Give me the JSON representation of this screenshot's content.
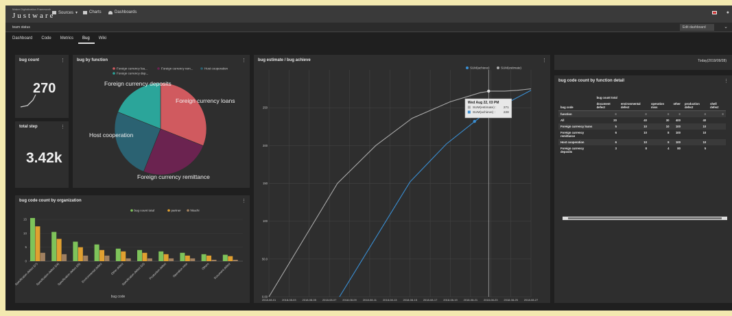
{
  "app": {
    "logo_small": "Maker Digitalization Framework",
    "logo": "Justware",
    "nav": [
      {
        "label": "Sources",
        "icon": "list-icon"
      },
      {
        "label": "Charts",
        "icon": "bar-chart-icon"
      },
      {
        "label": "Dashboards",
        "icon": "dashboard-icon"
      }
    ],
    "subtitle": "team status",
    "edit_button": "Edit dashboard"
  },
  "tabs": [
    "Dashboard",
    "Code",
    "Metrics",
    "Bug",
    "Wiki"
  ],
  "active_tab": "Bug",
  "bug_count": {
    "title": "bug count",
    "value": "270"
  },
  "total_step": {
    "title": "total step",
    "value": "3.42k"
  },
  "date_panel": {
    "text": "Today(2019/09/28)"
  },
  "pie": {
    "title": "bug by function",
    "legend": [
      "Foreign currency loa...",
      "Foreign currency rem...",
      "Host cooperation",
      "Foreign currency dep..."
    ],
    "labels": [
      "Foreign currency loans",
      "Foreign currency remittance",
      "Host cooperation",
      "Foreign currency deposits"
    ]
  },
  "bars": {
    "title": "bug code count by organization",
    "legend": [
      "bug count total",
      "partner",
      "hitachi"
    ],
    "xlabel": "bug code",
    "categories": [
      "Specification defect (07)",
      "Specification defect (04)",
      "Specification defect (05)",
      "Environmental defect",
      "Other defect",
      "Specification defect (02)",
      "Production defect",
      "Operation miss",
      "Others",
      "Document defect"
    ]
  },
  "line": {
    "title": "bug estimate / bug achieve",
    "legend": [
      "SUM(achieve)",
      "SUM(estimate)"
    ],
    "tooltip_title": "Wed Aug 22, 03 PM",
    "tooltip_rows": [
      {
        "label": "SUM(estimate)",
        "value": "271"
      },
      {
        "label": "SUM(achieve)",
        "value": "228"
      }
    ]
  },
  "table": {
    "title": "bug code count by function detail",
    "group_header": "bug count total",
    "row_header": "bug code",
    "subheader": "function",
    "columns": [
      "document defect",
      "environmental defect",
      "operation miss",
      "other",
      "production defect",
      "shell defect"
    ],
    "rows": [
      {
        "label": "All",
        "values": [
          "20",
          "40",
          "30",
          "400",
          "40"
        ]
      },
      {
        "label": "Foreign currency loans",
        "values": [
          "5",
          "10",
          "10",
          "100",
          "10"
        ]
      },
      {
        "label": "Foreign currency remittance",
        "values": [
          "6",
          "10",
          "8",
          "100",
          "10"
        ]
      },
      {
        "label": "Host cooperation",
        "values": [
          "6",
          "10",
          "9",
          "100",
          "10"
        ]
      },
      {
        "label": "Foreign currency deposits",
        "values": [
          "3",
          "8",
          "4",
          "80",
          "5"
        ]
      }
    ]
  },
  "chart_data": [
    {
      "type": "pie",
      "title": "bug by function",
      "categories": [
        "Foreign currency loans",
        "Foreign currency remittance",
        "Host cooperation",
        "Foreign currency deposits"
      ],
      "values": [
        31,
        25,
        25,
        19
      ],
      "colors": [
        "#d05a5f",
        "#6b2350",
        "#2b6272",
        "#2ba59a"
      ]
    },
    {
      "type": "bar",
      "title": "bug code count by organization",
      "xlabel": "bug code",
      "ylabel": "",
      "ylim": [
        0,
        16
      ],
      "yticks": [
        0,
        5,
        10,
        15
      ],
      "categories": [
        "Specification defect (07)",
        "Specification defect (04)",
        "Specification defect (05)",
        "Environmental defect",
        "Other defect",
        "Specification defect (02)",
        "Production defect",
        "Operation miss",
        "Others",
        "Document defect"
      ],
      "series": [
        {
          "name": "bug count total",
          "color": "#7ec35a",
          "values": [
            15.5,
            10.5,
            7,
            6,
            4.5,
            4,
            3.5,
            3,
            2.5,
            2.3
          ]
        },
        {
          "name": "partner",
          "color": "#e0a030",
          "values": [
            12.5,
            8,
            5,
            4,
            3.5,
            3,
            2.5,
            2,
            2,
            1.8
          ]
        },
        {
          "name": "hitachi",
          "color": "#a08060",
          "values": [
            3,
            2.5,
            2,
            2,
            1,
            1,
            1,
            1,
            0.5,
            0.5
          ]
        }
      ]
    },
    {
      "type": "line",
      "title": "bug estimate / bug achieve",
      "x": [
        "2018-08-01",
        "2018-08-03",
        "2018-08-05",
        "2018-08-07",
        "2018-08-09",
        "2018-08-11",
        "2018-08-13",
        "2018-08-15",
        "2018-08-17",
        "2018-08-19",
        "2018-08-21",
        "2018-08-23",
        "2018-08-25",
        "2018-08-27"
      ],
      "ylim": [
        0,
        300
      ],
      "yticks": [
        0,
        50,
        100,
        150,
        200,
        250
      ],
      "yticklabels": [
        "0.00",
        "50.0",
        "100",
        "150",
        "200",
        "250"
      ],
      "series": [
        {
          "name": "SUM(estimate)",
          "color": "#aaaaaa",
          "x_index": [
            0,
            1.7,
            3.4,
            5.3,
            7.1,
            9,
            10.5,
            11,
            11.7,
            12.3,
            13
          ],
          "values": [
            0,
            75,
            150,
            200,
            236,
            258,
            270,
            272,
            272,
            273,
            275
          ]
        },
        {
          "name": "SUM(achieve)",
          "color": "#3a8fd4",
          "x_index": [
            3.5,
            7,
            8.8,
            10.5,
            11,
            11.8,
            12.5,
            13
          ],
          "values": [
            0,
            152,
            202,
            238,
            248,
            256,
            266,
            273
          ]
        }
      ]
    }
  ]
}
